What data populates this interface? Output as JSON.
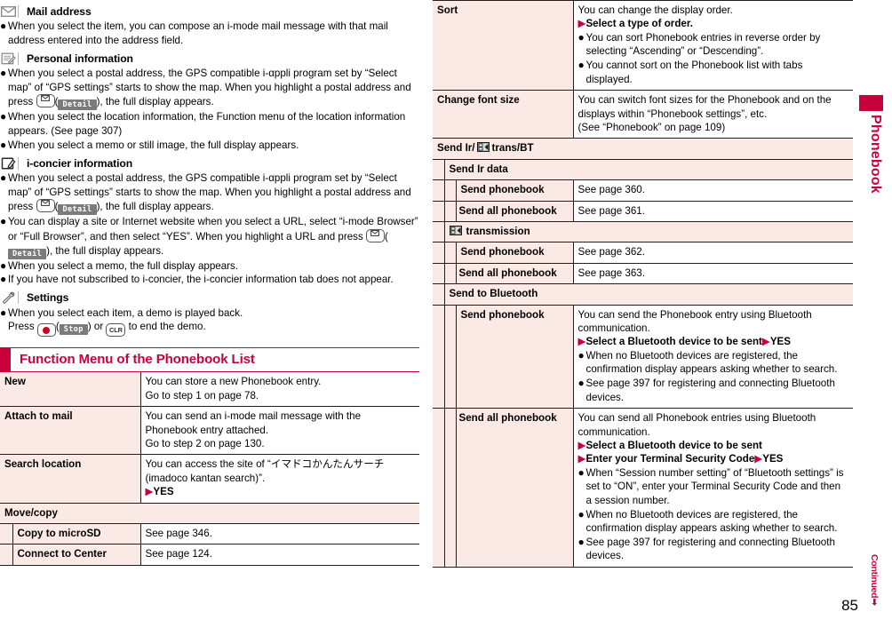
{
  "left_column": {
    "sections": [
      {
        "icon": "mail-envelope-icon",
        "title": "Mail address",
        "bullets": [
          {
            "text": "When you select the item, you can compose an i-mode mail message with that mail address entered into the address field."
          }
        ]
      },
      {
        "icon": "personal-information-note-icon",
        "title": "Personal information",
        "bullets": [
          {
            "text_1": "When you select a postal address, the GPS compatible i-αppli program set by “Select map” of “GPS settings” starts to show the map. When you highlight a postal address and press ",
            "key": "mail-key",
            "softkey": "Detail",
            "text_2": "), the full display appears."
          },
          {
            "text": "When you select the location information, the Function menu of the location information appears. (See page 307)"
          },
          {
            "text": "When you select a memo or still image, the full display appears."
          }
        ]
      },
      {
        "icon": "i-concier-information-icon",
        "title": "i-concier information",
        "bullets": [
          {
            "text_1": "When you select a postal address, the GPS compatible i-αppli program set by “Select map” of “GPS settings” starts to show the map. When you highlight a postal address and press ",
            "key": "mail-key",
            "softkey": "Detail",
            "text_2": "), the full display appears."
          },
          {
            "text_1": "You can display a site or Internet website when you select a URL, select “i-mode Browser” or “Full Browser”, and then select “YES”. When you highlight a URL and press ",
            "key": "mail-key",
            "softkey": "Detail",
            "text_2": "), the full display appears."
          },
          {
            "text": "When you select a memo, the full display appears."
          },
          {
            "text": "If you have not subscribed to i-concier, the i-concier information tab does not appear."
          }
        ]
      },
      {
        "icon": "settings-wrench-icon",
        "title": "Settings",
        "bullets": [
          {
            "text_1": "When you select each item, a demo is played back.",
            "text_2": "Press ",
            "key": "enter-key",
            "softkey": "Stop",
            "text_3": ") or ",
            "key2": "CLR",
            "text_4": " to end the demo."
          }
        ]
      }
    ],
    "section_title": "Function Menu of the Phonebook List",
    "table_rows": [
      {
        "kind": "kv",
        "key": "New",
        "lines": [
          {
            "text": "You can store a new Phonebook entry."
          },
          {
            "text": "Go to step 1 on page 78."
          }
        ]
      },
      {
        "kind": "kv",
        "key": "Attach to mail",
        "lines": [
          {
            "text": "You can send an i-mode mail message with the"
          },
          {
            "text": "Phonebook entry attached."
          },
          {
            "text": "Go to step 2 on page 130."
          }
        ]
      },
      {
        "kind": "kv",
        "key": "Search location",
        "lines": [
          {
            "text": "You can access the site of “イマドコかんたんサーチ"
          },
          {
            "text": "(imadoco kantan search)”."
          },
          {
            "text": "YES",
            "style": "arrow-bold"
          }
        ]
      },
      {
        "kind": "group",
        "key": "Move/copy"
      },
      {
        "kind": "sub",
        "key": "Copy to microSD",
        "lines": [
          {
            "text": "See page 346."
          }
        ]
      },
      {
        "kind": "sub",
        "key": "Connect to Center",
        "lines": [
          {
            "text": "See page 124."
          }
        ]
      }
    ]
  },
  "right_column": {
    "table_rows": [
      {
        "kind": "kv",
        "key": "Sort",
        "lines": [
          {
            "text": "You can change the display order."
          },
          {
            "text": "Select a type of order.",
            "style": "arrow-bold"
          },
          {
            "text": "You can sort Phonebook entries in reverse order by selecting “Ascending” or “Descending”.",
            "style": "bullet"
          },
          {
            "text": "You cannot sort on the Phonebook list with tabs displayed.",
            "style": "bullet"
          }
        ]
      },
      {
        "kind": "kv",
        "key": "Change font size",
        "lines": [
          {
            "text": "You can switch font sizes for the Phonebook and on the"
          },
          {
            "text": "displays within “Phonebook settings”, etc."
          },
          {
            "text": "(See “Phonebook” on page 109)"
          }
        ]
      },
      {
        "kind": "group-icon",
        "key_prefix": "Send Ir/",
        "icon": "ic-transmission-icon",
        "key_suffix": "trans/BT"
      },
      {
        "kind": "group2",
        "key": "Send Ir data"
      },
      {
        "kind": "sub2",
        "key": "Send phonebook",
        "lines": [
          {
            "text": "See page 360."
          }
        ]
      },
      {
        "kind": "sub2",
        "key": "Send all phonebook",
        "lines": [
          {
            "text": "See page 361."
          }
        ]
      },
      {
        "kind": "group2-icon",
        "icon": "ic-transmission-icon",
        "key": "transmission"
      },
      {
        "kind": "sub2",
        "key": "Send phonebook",
        "lines": [
          {
            "text": "See page 362."
          }
        ]
      },
      {
        "kind": "sub2",
        "key": "Send all phonebook",
        "lines": [
          {
            "text": "See page 363."
          }
        ]
      },
      {
        "kind": "group2",
        "key": "Send to Bluetooth"
      },
      {
        "kind": "sub2",
        "key": "Send phonebook",
        "lines": [
          {
            "text": "You can send the Phonebook entry using Bluetooth communication."
          },
          {
            "text": "Select a Bluetooth device to be sent",
            "text2": "YES",
            "style": "arrow-bold-double"
          },
          {
            "text": "When no Bluetooth devices are registered, the confirmation display appears asking whether to search.",
            "style": "bullet"
          },
          {
            "text": "See page 397 for registering and connecting Bluetooth devices.",
            "style": "bullet"
          }
        ]
      },
      {
        "kind": "sub2",
        "key": "Send all phonebook",
        "lines": [
          {
            "text": "You can send all Phonebook entries using Bluetooth communication."
          },
          {
            "text": "Select a Bluetooth device to be sent",
            "style": "arrow-bold"
          },
          {
            "text": "Enter your Terminal Security Code",
            "text2": "YES",
            "style": "arrow-bold-double"
          },
          {
            "text": "When “Session number setting” of “Bluetooth settings” is set to “ON”, enter your Terminal Security Code and then a session number.",
            "style": "bullet"
          },
          {
            "text": "When no Bluetooth devices are registered, the confirmation display appears asking whether to search.",
            "style": "bullet"
          },
          {
            "text": "See page 397 for registering and connecting Bluetooth devices.",
            "style": "bullet"
          }
        ]
      }
    ]
  },
  "side_tab": {
    "label": "Phonebook"
  },
  "footer": {
    "continued": "Continued",
    "page_number": "85"
  },
  "colors": {
    "accent": "#c8003c",
    "key_cell_bg": "#fae9e4",
    "rule": "#231f20"
  }
}
